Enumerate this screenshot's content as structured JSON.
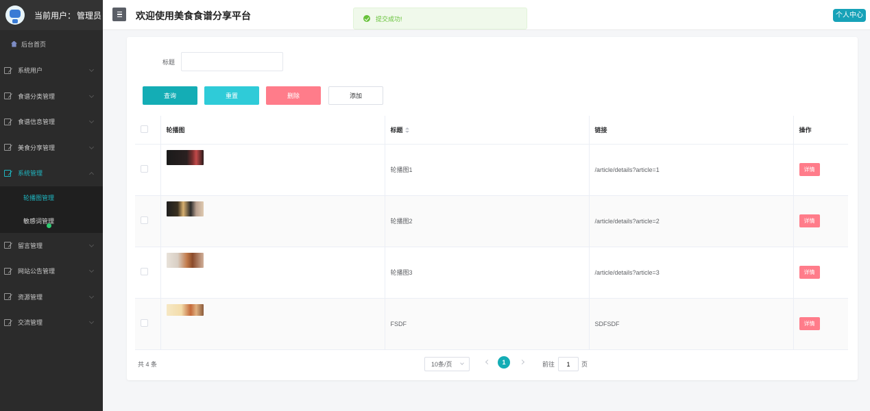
{
  "sidebar": {
    "current_user_prefix": "当前用户：",
    "current_user_name": "管理员",
    "home_label": "后台首页",
    "menus": [
      {
        "label": "系统用户"
      },
      {
        "label": "食谱分类管理"
      },
      {
        "label": "食谱信息管理"
      },
      {
        "label": "美食分享管理"
      },
      {
        "label": "系统管理",
        "expanded": true
      }
    ],
    "submenus": [
      {
        "label": "轮播图管理",
        "active": true
      },
      {
        "label": "敏感词管理"
      }
    ],
    "menus_after": [
      {
        "label": "留言管理"
      },
      {
        "label": "网站公告管理"
      },
      {
        "label": "资源管理"
      },
      {
        "label": "交流管理"
      }
    ]
  },
  "header": {
    "title": "欢迎使用美食食谱分享平台",
    "user_center": "个人中心"
  },
  "toast": {
    "message": "提交成功!"
  },
  "search": {
    "label": "标题",
    "value": "",
    "placeholder": ""
  },
  "buttons": {
    "query": "查询",
    "reset": "重置",
    "delete": "删除",
    "add": "添加"
  },
  "table": {
    "columns": [
      "轮播图",
      "标题",
      "链接",
      "操作"
    ],
    "rows": [
      {
        "title": "轮播图1",
        "link": "/article/details?article=1",
        "action": "详情"
      },
      {
        "title": "轮播图2",
        "link": "/article/details?article=2",
        "action": "详情"
      },
      {
        "title": "轮播图3",
        "link": "/article/details?article=3",
        "action": "详情"
      },
      {
        "title": "FSDF",
        "link": "SDFSDF",
        "action": "详情"
      }
    ]
  },
  "pagination": {
    "total": "共 4 条",
    "page_size": "10条/页",
    "current_page": "1",
    "goto_prefix": "前往",
    "goto_value": "1",
    "goto_suffix": "页"
  },
  "colors": {
    "accent": "#14adb5",
    "danger": "#ff7c8a",
    "sidebar_bg": "#2b2b2b"
  }
}
